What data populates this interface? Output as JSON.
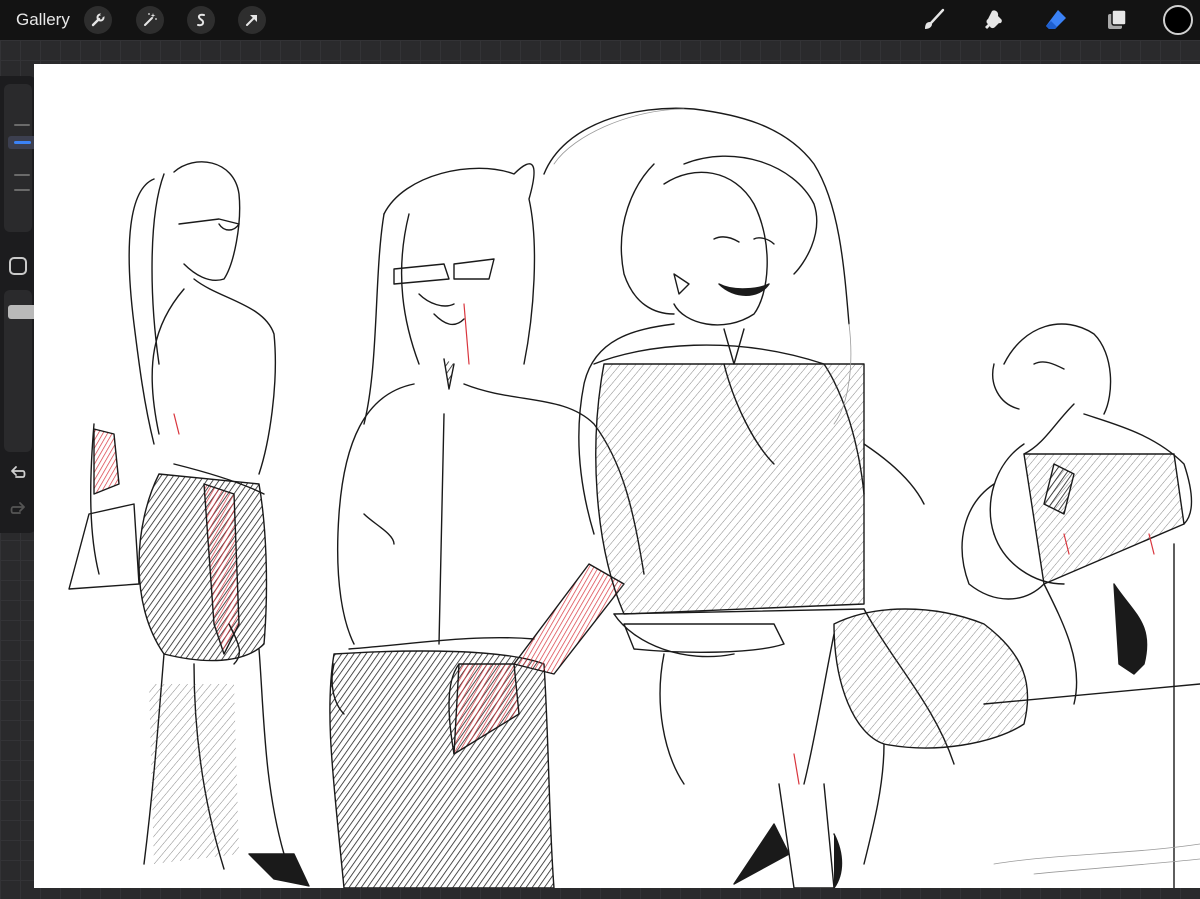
{
  "toolbar": {
    "gallery_label": "Gallery",
    "left_tools": [
      "wrench-icon",
      "magic-wand-icon",
      "selection-icon",
      "transform-arrow-icon"
    ],
    "right_tools": [
      "brush-icon",
      "smudge-icon",
      "eraser-icon",
      "layers-icon"
    ],
    "active_tool": "eraser",
    "current_color": "#000000"
  },
  "sidebar": {
    "brush_size_level": 0.3,
    "opacity_level": 0.1
  },
  "colors": {
    "accent": "#3b82f6",
    "canvas": "#ffffff",
    "ink": "#1a1a1a",
    "red_pencil": "#d9363e"
  }
}
